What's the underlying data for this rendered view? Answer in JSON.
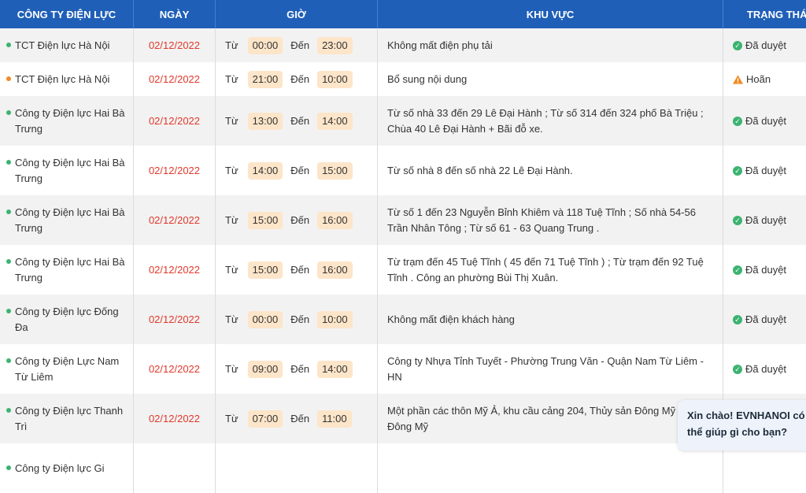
{
  "header": {
    "company": "CÔNG TY ĐIỆN LỰC",
    "date": "NGÀY",
    "time": "GIỜ",
    "area": "KHU VỰC",
    "status": "TRẠNG THÁI"
  },
  "labels": {
    "from": "Từ",
    "to": "Đến"
  },
  "rows": [
    {
      "company": "TCT Điện lực Hà Nội",
      "dot": "green",
      "date": "02/12/2022",
      "from": "00:00",
      "to": "23:00",
      "area": "Không mất điện phụ tải",
      "status": "Đã duyệt",
      "status_icon": "check-circle-icon"
    },
    {
      "company": "TCT Điện lực Hà Nội",
      "dot": "orange",
      "date": "02/12/2022",
      "from": "21:00",
      "to": "10:00",
      "area": "Bổ sung nội dung",
      "status": "Hoãn",
      "status_icon": "warning-icon"
    },
    {
      "company": "Công ty Điện lực Hai Bà Trưng",
      "dot": "green",
      "date": "02/12/2022",
      "from": "13:00",
      "to": "14:00",
      "area": "Từ số nhà 33 đến 29 Lê Đại Hành ; Từ số 314 đến 324 phố Bà Triệu ; Chùa 40 Lê Đại Hành + Bãi đỗ xe.",
      "status": "Đã duyệt",
      "status_icon": "check-circle-icon"
    },
    {
      "company": "Công ty Điện lực Hai Bà Trưng",
      "dot": "green",
      "date": "02/12/2022",
      "from": "14:00",
      "to": "15:00",
      "area": "Từ số nhà 8 đến số nhà 22 Lê Đại Hành.",
      "status": "Đã duyệt",
      "status_icon": "check-circle-icon"
    },
    {
      "company": "Công ty Điện lực Hai Bà Trưng",
      "dot": "green",
      "date": "02/12/2022",
      "from": "15:00",
      "to": "16:00",
      "area": "Từ số 1 đến 23 Nguyễn Bỉnh Khiêm và 118 Tuệ Tĩnh ; Số nhà 54-56 Trần Nhân Tông ; Từ số 61 - 63 Quang Trung .",
      "status": "Đã duyệt",
      "status_icon": "check-circle-icon"
    },
    {
      "company": "Công ty Điện lực Hai Bà Trưng",
      "dot": "green",
      "date": "02/12/2022",
      "from": "15:00",
      "to": "16:00",
      "area": "Từ trạm đến 45 Tuệ Tĩnh ( 45 đến 71 Tuệ Tĩnh ) ; Từ trạm đến 92 Tuệ Tĩnh . Công an phường Bùi Thị Xuân.",
      "status": "Đã duyệt",
      "status_icon": "check-circle-icon"
    },
    {
      "company": "Công ty Điện lực Đống Đa",
      "dot": "green",
      "date": "02/12/2022",
      "from": "00:00",
      "to": "10:00",
      "area": "Không mất điện khách hàng",
      "status": "Đã duyệt",
      "status_icon": "check-circle-icon"
    },
    {
      "company": "Công ty Điện Lực Nam Từ Liêm",
      "dot": "green",
      "date": "02/12/2022",
      "from": "09:00",
      "to": "14:00",
      "area": "Công ty Nhựa Tỉnh Tuyết - Phường Trung Văn - Quận Nam Từ Liêm - HN",
      "status": "Đã duyệt",
      "status_icon": "check-circle-icon"
    },
    {
      "company": "Công ty Điện lực Thanh Trì",
      "dot": "green",
      "date": "02/12/2022",
      "from": "07:00",
      "to": "11:00",
      "area": "Một phần các thôn Mỹ Ả, khu cầu cảng 204, Thủy sản Đông Mỹ - xã Đông Mỹ",
      "status": "",
      "status_icon": ""
    },
    {
      "company": "Công ty Điện lực Gi",
      "dot": "green",
      "date": "",
      "from": "",
      "to": "",
      "area": "",
      "status": "",
      "status_icon": ""
    }
  ],
  "chat": {
    "greeting": "Xin chào! EVNHANOI có thể giúp gì cho bạn?"
  },
  "colors": {
    "header_bg": "#1f5fb8",
    "date": "#e0392b",
    "pill": "#fde5c9",
    "ok": "#3cb371",
    "warn": "#f08a24"
  }
}
